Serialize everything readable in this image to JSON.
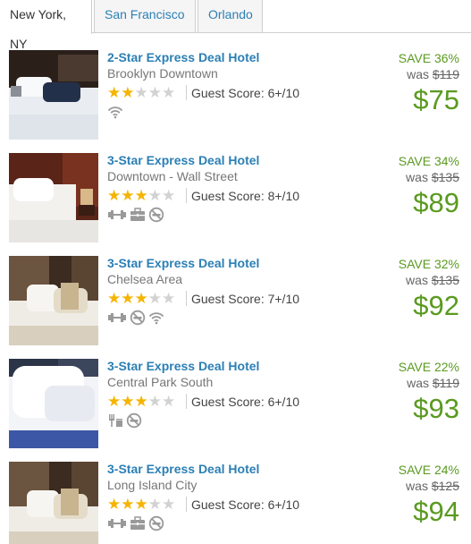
{
  "tabs": [
    {
      "label": "New York, NY",
      "active": true
    },
    {
      "label": "San Francisco",
      "active": false
    },
    {
      "label": "Orlando",
      "active": false
    }
  ],
  "deals": [
    {
      "name": "2-Star Express Deal Hotel",
      "area": "Brooklyn Downtown",
      "stars": 2,
      "stars_max": 5,
      "score": "Guest Score: 6+/10",
      "amenities": [
        "wifi-icon"
      ],
      "save": "SAVE 36%",
      "was_label": "was",
      "was_price": "$119",
      "price": "$75",
      "image": "hotel-bed-photo"
    },
    {
      "name": "3-Star Express Deal Hotel",
      "area": "Downtown - Wall Street",
      "stars": 3,
      "stars_max": 5,
      "score": "Guest Score: 8+/10",
      "amenities": [
        "fitness-icon",
        "business-center-icon",
        "no-smoking-icon"
      ],
      "save": "SAVE 34%",
      "was_label": "was",
      "was_price": "$135",
      "price": "$89",
      "image": "hotel-bed-photo"
    },
    {
      "name": "3-Star Express Deal Hotel",
      "area": "Chelsea Area",
      "stars": 3,
      "stars_max": 5,
      "score": "Guest Score: 7+/10",
      "amenities": [
        "fitness-icon",
        "no-smoking-icon",
        "wifi-icon"
      ],
      "save": "SAVE 32%",
      "was_label": "was",
      "was_price": "$135",
      "price": "$92",
      "image": "hotel-bed-photo"
    },
    {
      "name": "3-Star Express Deal Hotel",
      "area": "Central Park South",
      "stars": 3,
      "stars_max": 5,
      "score": "Guest Score: 6+/10",
      "amenities": [
        "restaurant-icon",
        "no-smoking-icon"
      ],
      "save": "SAVE 22%",
      "was_label": "was",
      "was_price": "$119",
      "price": "$93",
      "image": "hotel-bed-photo"
    },
    {
      "name": "3-Star Express Deal Hotel",
      "area": "Long Island City",
      "stars": 3,
      "stars_max": 5,
      "score": "Guest Score: 6+/10",
      "amenities": [
        "fitness-icon",
        "business-center-icon",
        "no-smoking-icon"
      ],
      "save": "SAVE 24%",
      "was_label": "was",
      "was_price": "$125",
      "price": "$94",
      "image": "hotel-bed-photo"
    }
  ],
  "colors": {
    "link": "#2b7fb5",
    "save_green": "#5a9a1f",
    "star_gold": "#f5b400",
    "star_grey": "#d2d2d2",
    "muted_text": "#777777"
  }
}
